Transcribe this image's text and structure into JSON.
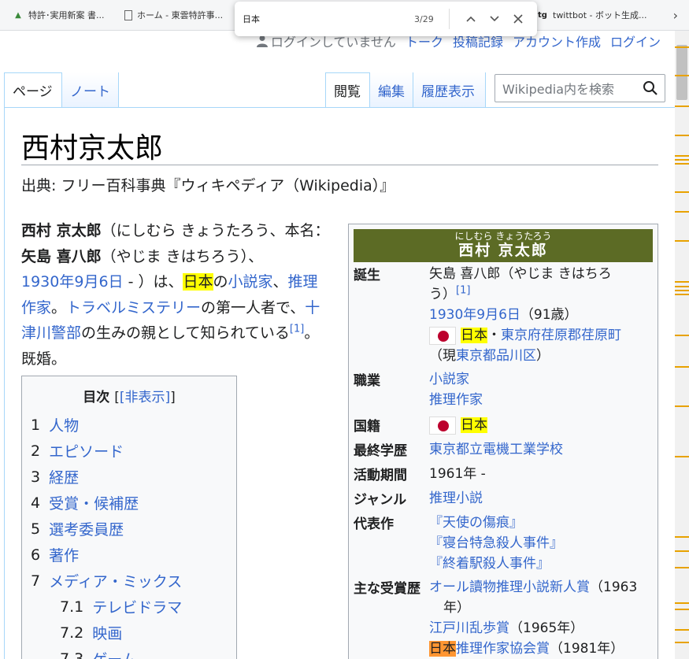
{
  "bookmarks": [
    {
      "icon": "patent-icon",
      "label": "特許･実用新案 書..."
    },
    {
      "icon": "page-icon",
      "label": "ホーム - 東雲特許事..."
    },
    {
      "icon": "tg-icon",
      "label": "twittbot - ボット生成..."
    }
  ],
  "find": {
    "query": "日本",
    "count": "3/29"
  },
  "user": {
    "not_logged": "ログインしていません",
    "talk": "トーク",
    "contributions": "投稿記録",
    "create_account": "アカウント作成",
    "login": "ログイン"
  },
  "tabs": {
    "page": "ページ",
    "talk": "ノート",
    "read": "閲覧",
    "edit": "編集",
    "history": "履歴表示"
  },
  "search": {
    "placeholder": "Wikipedia内を検索"
  },
  "article": {
    "title": "西村京太郎",
    "from": "出典: フリー百科事典『ウィキペディア（Wikipedia）』",
    "lead": {
      "name1": "西村 京太郎",
      "reading1": "（にしむら きょうたろう、本名：",
      "name2": "矢島 喜八郎",
      "reading2": "（やじま きはちろう）、",
      "birth_link": "1930年9月6日",
      "dash": " - ",
      "after": "）は、",
      "japan": "日本",
      "of": "の",
      "novelist": "小説家",
      "comma": "、",
      "mystery": "推理作家",
      "period": "。",
      "travel": "トラベルミステリー",
      "first": "の第一人者で、",
      "totsugawa": "十津川警部",
      "parent": "の生みの親として知られている",
      "ref": "[1]",
      "married": "。既婚。"
    }
  },
  "toc": {
    "title": "目次",
    "toggle": "[非表示]",
    "items": [
      {
        "num": "1",
        "label": "人物"
      },
      {
        "num": "2",
        "label": "エピソード"
      },
      {
        "num": "3",
        "label": "経歴"
      },
      {
        "num": "4",
        "label": "受賞・候補歴"
      },
      {
        "num": "5",
        "label": "選考委員歴"
      },
      {
        "num": "6",
        "label": "著作"
      },
      {
        "num": "7",
        "label": "メディア・ミックス"
      },
      {
        "num": "7.1",
        "label": "テレビドラマ"
      },
      {
        "num": "7.2",
        "label": "映画"
      },
      {
        "num": "7.3",
        "label": "ゲーム"
      }
    ]
  },
  "infobox": {
    "ruby": "にしむら きょうたろう",
    "name": "西村 京太郎",
    "birth": {
      "label": "誕生",
      "real_name": "矢島 喜八郎（やじま きはちろ",
      "real_name2": "う）",
      "ref": "[1]",
      "date": "1930年9月6日",
      "age": "（91歳）",
      "japan": "日本",
      "sep": "・",
      "place": "東京府荏原郡荏原町",
      "current_open": "（現",
      "current": "東京都品川区",
      "current_close": "）"
    },
    "occupation": {
      "label": "職業",
      "v1": "小説家",
      "v2": "推理作家"
    },
    "nationality": {
      "label": "国籍",
      "value": "日本"
    },
    "education": {
      "label": "最終学歴",
      "value": "東京都立電機工業学校"
    },
    "active": {
      "label": "活動期間",
      "value": "1961年 -"
    },
    "genre": {
      "label": "ジャンル",
      "value": "推理小説"
    },
    "works": {
      "label": "代表作",
      "w1": "『天使の傷痕』",
      "w2": "『寝台特急殺人事件』",
      "w3": "『終着駅殺人事件』"
    },
    "awards": {
      "label": "主な受賞歴",
      "a1": "オール讀物推理小説新人賞",
      "a1_year": "（1963",
      "a1_year2": "年）",
      "a2": "江戸川乱歩賞",
      "a2_year": "（1965年）",
      "a3_jp": "日本",
      "a3": "推理作家協会賞",
      "a3_year": "（1981年）"
    }
  }
}
